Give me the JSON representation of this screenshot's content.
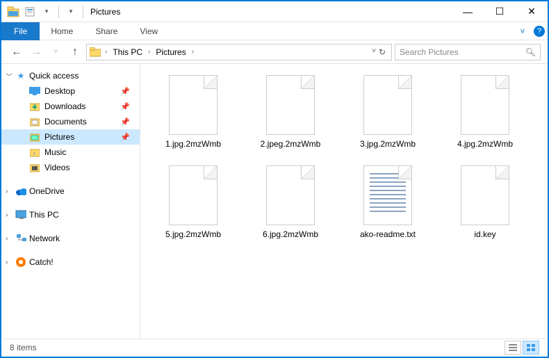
{
  "window": {
    "title": "Pictures",
    "controls": {
      "min": "—",
      "max": "☐",
      "close": "✕"
    }
  },
  "ribbon": {
    "file": "File",
    "tabs": [
      "Home",
      "Share",
      "View"
    ]
  },
  "address": {
    "breadcrumb": [
      "This PC",
      "Pictures"
    ],
    "search_placeholder": "Search Pictures"
  },
  "sidebar": {
    "quick_access": {
      "label": "Quick access",
      "items": [
        {
          "label": "Desktop",
          "pinned": true,
          "icon": "desktop"
        },
        {
          "label": "Downloads",
          "pinned": true,
          "icon": "downloads"
        },
        {
          "label": "Documents",
          "pinned": true,
          "icon": "documents"
        },
        {
          "label": "Pictures",
          "pinned": true,
          "icon": "pictures",
          "selected": true
        },
        {
          "label": "Music",
          "pinned": false,
          "icon": "music"
        },
        {
          "label": "Videos",
          "pinned": false,
          "icon": "videos"
        }
      ]
    },
    "roots": [
      {
        "label": "OneDrive",
        "icon": "onedrive"
      },
      {
        "label": "This PC",
        "icon": "thispc"
      },
      {
        "label": "Network",
        "icon": "network"
      },
      {
        "label": "Catch!",
        "icon": "catch"
      }
    ]
  },
  "files": [
    {
      "name": "1.jpg.2mzWmb",
      "kind": "blank"
    },
    {
      "name": "2.jpeg.2mzWmb",
      "kind": "blank"
    },
    {
      "name": "3.jpg.2mzWmb",
      "kind": "blank"
    },
    {
      "name": "4.jpg.2mzWmb",
      "kind": "blank"
    },
    {
      "name": "5.jpg.2mzWmb",
      "kind": "blank"
    },
    {
      "name": "6.jpg.2mzWmb",
      "kind": "blank"
    },
    {
      "name": "ako-readme.txt",
      "kind": "text"
    },
    {
      "name": "id.key",
      "kind": "blank"
    }
  ],
  "status": {
    "count_label": "8 items"
  },
  "colors": {
    "accent": "#0078d7",
    "selection": "#cce8ff"
  }
}
